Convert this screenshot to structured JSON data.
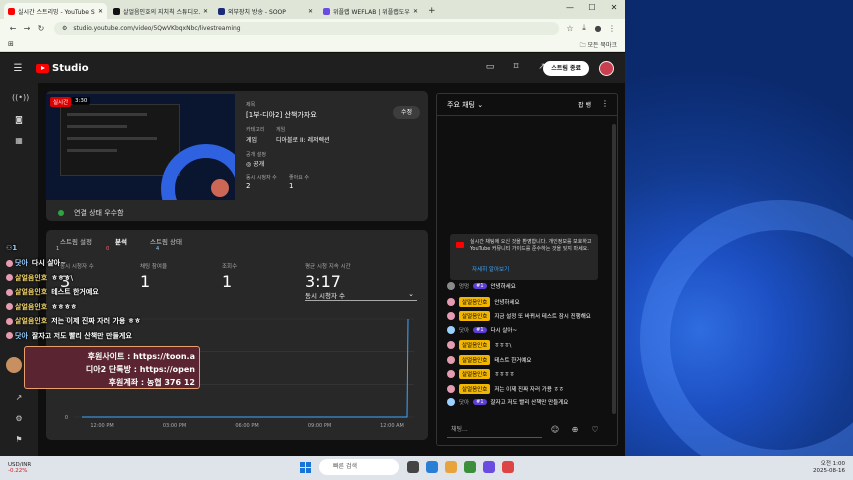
{
  "browser": {
    "tabs": [
      {
        "title": "실시간 스트리밍 - YouTube Stu...",
        "color": "#ff0000",
        "active": true
      },
      {
        "title": "살얼음인호의 지치칙 스튜디오...",
        "color": "#111111",
        "active": false
      },
      {
        "title": "외부장치 방송 - SOOP",
        "color": "#1b2b7a",
        "active": false
      },
      {
        "title": "위플랩 WEFLAB | 위플랩도우미...",
        "color": "#6a4ce0",
        "active": false
      }
    ],
    "url": "studio.youtube.com/video/5QwVKbqxNbc/livestreaming",
    "bookmark_folder": "모든 북마크"
  },
  "header": {
    "logo_text": "Studio",
    "end_stream_label": "스트림 종료"
  },
  "stream_card": {
    "live_badge": "실시간",
    "live_time": "3:30",
    "title_label": "제목",
    "title": "[1부-디아2] 산책가자요",
    "edit_label": "수정",
    "category_label": "카테고리",
    "category": "게임",
    "game_label": "게임",
    "game": "디아블로 II: 레저렉션",
    "privacy_label": "공개 설정",
    "privacy": "공개",
    "concurrent_label": "동시 시청자 수",
    "concurrent": "2",
    "likes_label": "좋아요 수",
    "likes": "1",
    "connection": "연결 상태 우수함"
  },
  "analytics": {
    "tabs": [
      {
        "label": "스트림 설정"
      },
      {
        "label": "분석"
      },
      {
        "label": "스트림 상태"
      }
    ],
    "tab_counts": [
      "1",
      "0",
      "4"
    ],
    "stats": [
      {
        "label": "동시 시청자 수",
        "value": "3"
      },
      {
        "label": "채팅 참여율",
        "value": "1"
      },
      {
        "label": "조회수",
        "value": "1"
      },
      {
        "label": "평균 시청 지속 시간",
        "value": "3:17"
      }
    ],
    "dropdown": "동시 시청자 수"
  },
  "chart_data": {
    "type": "line",
    "x": [
      "12:00 PM",
      "03:00 PM",
      "06:00 PM",
      "09:00 PM",
      "12:00 AM"
    ],
    "ytick_labels": [
      "3",
      "0"
    ],
    "ylim": [
      0,
      3
    ],
    "series": [
      {
        "values": [
          0,
          0,
          0,
          0,
          0,
          3
        ]
      }
    ],
    "grid": true
  },
  "chat": {
    "header": "주요 채팅",
    "pin_label": "팝 뱅",
    "notice": "실시간 채팅에 오신 것을 환영합니다. 개인정보를 보호하고 YouTube 커뮤니티 가이드를 준수하는 것을 잊지 마세요.",
    "notice_link": "자세히 알아보기",
    "messages": [
      {
        "author": "멍멍",
        "badge": "",
        "member": "#1",
        "text": "안녕하세요",
        "color": "#8a8a8a"
      },
      {
        "author": "",
        "badge": "살얼음인호",
        "member": "",
        "text": "안녕하세요",
        "color": "#e59cb0"
      },
      {
        "author": "",
        "badge": "살얼음인호",
        "member": "",
        "text": "지금 설정 또 바뀌서 테스트 잠시 진행해요",
        "color": "#e59cb0"
      },
      {
        "author": "닷아",
        "badge": "",
        "member": "#1",
        "text": "다시 살아~",
        "color": "#9bd0ff"
      },
      {
        "author": "",
        "badge": "살얼음인호",
        "member": "",
        "text": "ㅎㅎㅎ\\",
        "color": "#e59cb0"
      },
      {
        "author": "",
        "badge": "살얼음인호",
        "member": "",
        "text": "테스트 한거예요",
        "color": "#e59cb0"
      },
      {
        "author": "",
        "badge": "살얼음인호",
        "member": "",
        "text": "ㅎㅎㅎㅎ",
        "color": "#e59cb0"
      },
      {
        "author": "",
        "badge": "살얼음인호",
        "member": "",
        "text": "저는 이제 진짜 자러 가용 ㅎㅎ",
        "color": "#e59cb0"
      },
      {
        "author": "닷아",
        "badge": "",
        "member": "#1",
        "text": "잘자고 저도 빨리 산책만 만들게요",
        "color": "#9bd0ff"
      }
    ],
    "input_placeholder": "채팅..."
  },
  "overlay": {
    "counter": "1",
    "lines": [
      {
        "name": "닷아",
        "text": "다시 살아~"
      },
      {
        "name": "살얼음인호",
        "text": "ㅎㅎㅎ\\"
      },
      {
        "name": "살얼음인호",
        "text": "테스트 한거예요"
      },
      {
        "name": "살얼음인호",
        "text": "ㅎㅎㅎㅎ"
      },
      {
        "name": "살얼음인호",
        "text": "저는 이제 진짜 자러 가용 ㅎㅎ"
      },
      {
        "name": "닷아",
        "text": "잘자고 저도 빨리 산책만 만들게요"
      }
    ],
    "donate": [
      "후원사이트 : https://toon.a",
      "디아2 단톡방 : https://open",
      "후원계좌 : 농협 376 12"
    ]
  },
  "taskbar": {
    "ticker": "USD/INR",
    "change": "-0.22%",
    "search": "빠른 검색",
    "time": "오전 1:00",
    "date": "2025-08-16"
  }
}
